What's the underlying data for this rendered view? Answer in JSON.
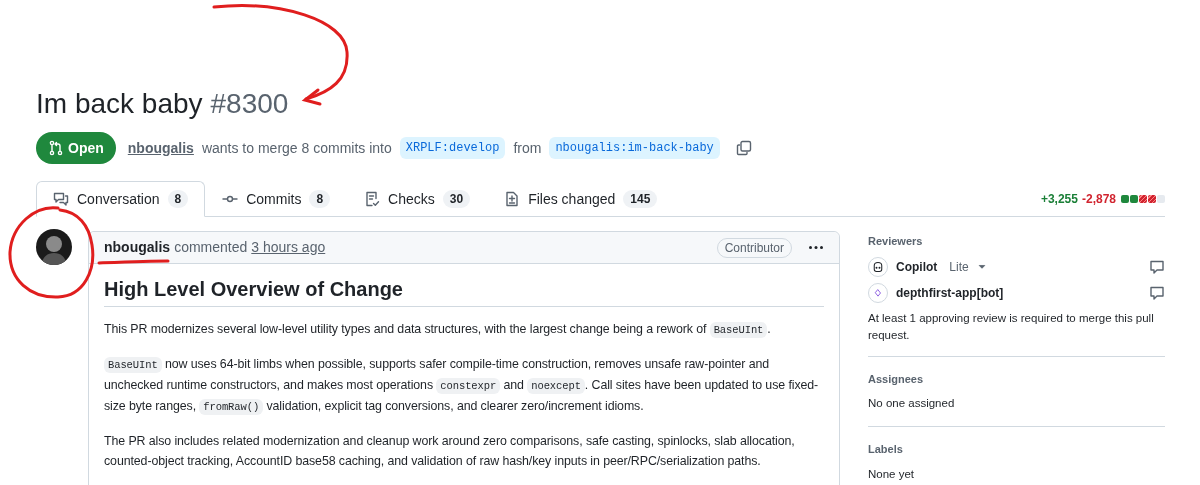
{
  "title": {
    "text": "Im back baby",
    "number": "#8300"
  },
  "state": {
    "label": "Open",
    "kind": "open"
  },
  "merge_info": {
    "author": "nbougalis",
    "text": "wants to merge 8 commits into",
    "base": "XRPLF:develop",
    "from": "from",
    "head": "nbougalis:im-back-baby"
  },
  "tabs": [
    {
      "label": "Conversation",
      "count": "8",
      "selected": true
    },
    {
      "label": "Commits",
      "count": "8",
      "selected": false
    },
    {
      "label": "Checks",
      "count": "30",
      "selected": false
    },
    {
      "label": "Files changed",
      "count": "145",
      "selected": false
    }
  ],
  "diffstat": {
    "added": "+3,255",
    "deleted": "-2,878",
    "blocks": [
      {
        "kind": "added"
      },
      {
        "kind": "added"
      },
      {
        "kind": "deleted"
      },
      {
        "kind": "deleted"
      },
      {
        "kind": "neutral"
      }
    ]
  },
  "comment": {
    "author": "nbougalis",
    "action": "commented",
    "time": "3 hours ago",
    "badge": "Contributor",
    "heading": "High Level Overview of Change",
    "paragraphs": [
      [
        {
          "kind": "text",
          "text": "This PR modernizes several low-level utility types and data structures, with the largest change being a rework of "
        },
        {
          "kind": "code",
          "text": "BaseUInt"
        },
        {
          "kind": "text",
          "text": "."
        }
      ],
      [
        {
          "kind": "code",
          "text": "BaseUInt"
        },
        {
          "kind": "text",
          "text": " now uses 64-bit limbs when possible, supports safer compile-time construction, removes unsafe raw-pointer and unchecked runtime constructors, and makes most operations "
        },
        {
          "kind": "code",
          "text": "constexpr"
        },
        {
          "kind": "text",
          "text": " and "
        },
        {
          "kind": "code",
          "text": "noexcept"
        },
        {
          "kind": "text",
          "text": ". Call sites have been updated to use fixed-size byte ranges, "
        },
        {
          "kind": "code",
          "text": "fromRaw()"
        },
        {
          "kind": "text",
          "text": " validation, explicit tag conversions, and clearer zero/increment idioms."
        }
      ],
      [
        {
          "kind": "text",
          "text": "The PR also includes related modernization and cleanup work around zero comparisons, safe casting, spinlocks, slab allocation, counted-object tracking, AccountID base58 caching, and validation of raw hash/key inputs in peer/RPC/serialization paths."
        }
      ]
    ]
  },
  "sidebar": {
    "reviewers": {
      "title": "Reviewers",
      "items": [
        {
          "name": "Copilot",
          "tag": "Lite",
          "kind": "copilot"
        },
        {
          "name": "depthfirst-app[bot]",
          "kind": "app"
        }
      ],
      "note": "At least 1 approving review is required to merge this pull request."
    },
    "assignees": {
      "title": "Assignees",
      "value": "No one assigned"
    },
    "labels": {
      "title": "Labels",
      "value": "None yet"
    }
  },
  "annotations": [
    {
      "kind": "arrow"
    },
    {
      "kind": "circle"
    },
    {
      "kind": "underline"
    }
  ]
}
